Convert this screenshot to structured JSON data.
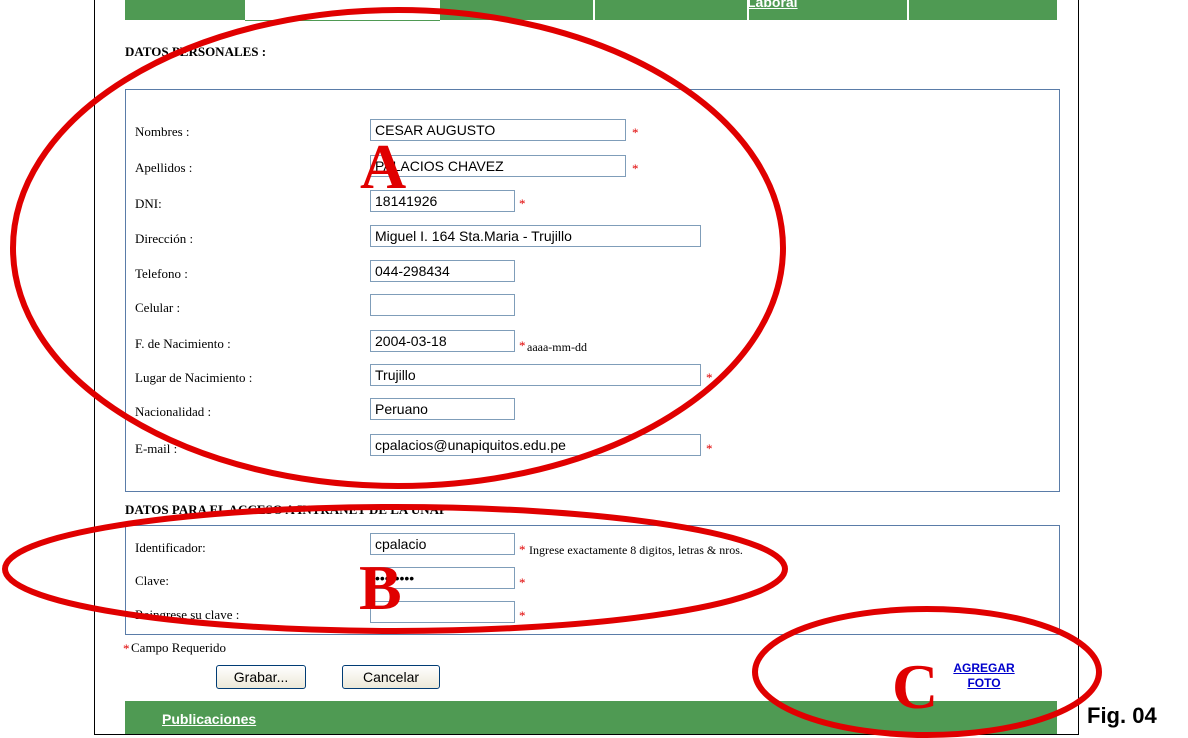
{
  "nav": {
    "tab_label": "Laboral"
  },
  "personal": {
    "title": "DATOS PERSONALES :",
    "fields": [
      {
        "label": "Nombres :",
        "value": "CESAR AUGUSTO",
        "required": "*"
      },
      {
        "label": "Apellidos :",
        "value": "PALACIOS CHAVEZ",
        "required": "*"
      },
      {
        "label": "DNI:",
        "value": "18141926",
        "required": "*"
      },
      {
        "label": "Dirección :",
        "value": "Miguel I. 164 Sta.Maria - Trujillo",
        "required": ""
      },
      {
        "label": "Telefono :",
        "value": "044-298434",
        "required": ""
      },
      {
        "label": "Celular :",
        "value": "",
        "required": ""
      },
      {
        "label": "F. de Nacimiento :",
        "value": "2004-03-18",
        "required": "*",
        "hint": "aaaa-mm-dd"
      },
      {
        "label": "Lugar de Nacimiento :",
        "value": "Trujillo",
        "required": "*"
      },
      {
        "label": "Nacionalidad :",
        "value": "Peruano",
        "required": ""
      },
      {
        "label": "E-mail :",
        "value": "cpalacios@unapiquitos.edu.pe",
        "required": "*"
      }
    ]
  },
  "access": {
    "title": "DATOS PARA EL ACCESO A INTRANET DE LA UNAP",
    "fields": [
      {
        "label": "Identificador:",
        "value": "cpalacio",
        "required": "*",
        "hint": "Ingrese exactamente 8 digitos, letras & nros."
      },
      {
        "label": "Clave:",
        "value": "••••••••",
        "required": "*"
      },
      {
        "label": "Reingrese su clave :",
        "value": "",
        "required": "*"
      }
    ]
  },
  "required_note": {
    "star": "*",
    "text": "Campo Requerido"
  },
  "buttons": {
    "save": "Grabar...",
    "cancel": "Cancelar"
  },
  "photo_link": {
    "line1": "AGREGAR",
    "line2": "FOTO"
  },
  "footer": {
    "label": "Publicaciones"
  },
  "annotations": {
    "a": "A",
    "b": "B",
    "c": "C",
    "figure": "Fig. 04",
    "color": "#e00000"
  },
  "colors": {
    "green": "#4f9a53",
    "box_border": "#5a7ca8",
    "required": "#e00000",
    "link": "#0000cc"
  }
}
